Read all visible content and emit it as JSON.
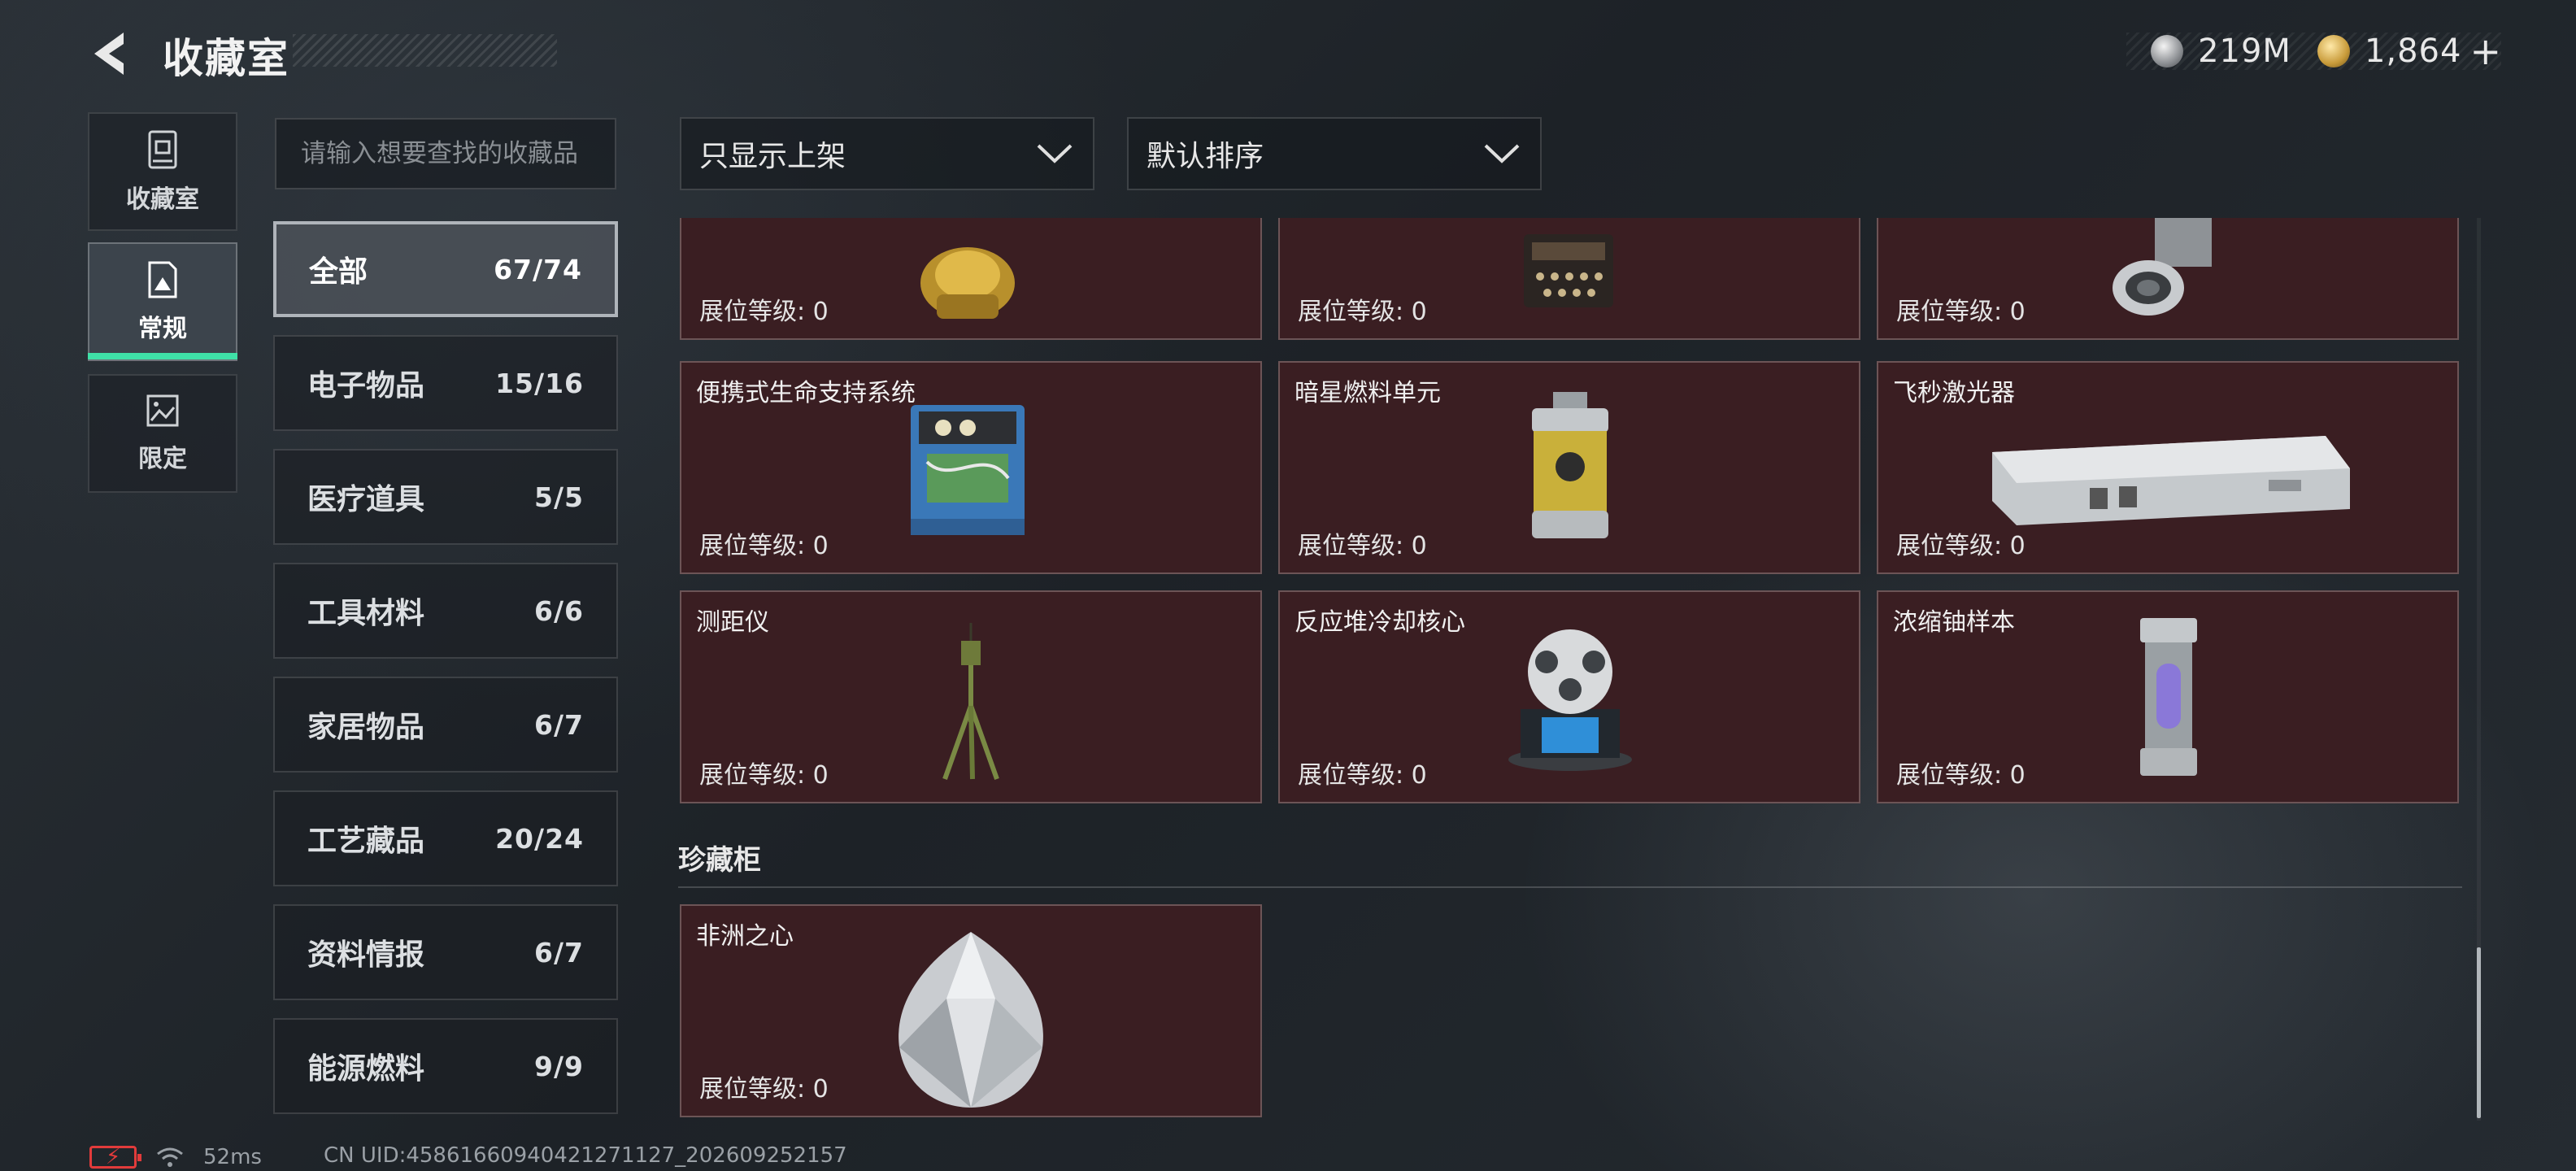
{
  "header": {
    "title": "收藏室"
  },
  "currency": {
    "silver": {
      "icon": "silver-coin-icon",
      "value": "219M"
    },
    "gold": {
      "icon": "gold-coin-icon",
      "value": "1,864"
    },
    "add_label": "+"
  },
  "side_tabs": [
    {
      "label": "收藏室",
      "icon": "collection-icon",
      "active": false
    },
    {
      "label": "常规",
      "icon": "frame-icon",
      "active": true
    },
    {
      "label": "限定",
      "icon": "image-icon",
      "active": false
    }
  ],
  "search": {
    "placeholder": "请输入想要查找的收藏品"
  },
  "filters": {
    "shelf_filter": "只显示上架",
    "sort": "默认排序"
  },
  "categories": [
    {
      "label": "全部",
      "count": "67/74",
      "active": true
    },
    {
      "label": "电子物品",
      "count": "15/16"
    },
    {
      "label": "医疗道具",
      "count": "5/5"
    },
    {
      "label": "工具材料",
      "count": "6/6"
    },
    {
      "label": "家居物品",
      "count": "6/7"
    },
    {
      "label": "工艺藏品",
      "count": "20/24"
    },
    {
      "label": "资料情报",
      "count": "6/7"
    },
    {
      "label": "能源燃料",
      "count": "9/9"
    }
  ],
  "level_label": "展位等级: 0",
  "items_partial": [
    {
      "name": "",
      "icon": "gold-statue-icon"
    },
    {
      "name": "",
      "icon": "typewriter-icon"
    },
    {
      "name": "",
      "icon": "lens-device-icon"
    }
  ],
  "items": [
    {
      "name": "便携式生命支持系统",
      "icon": "life-support-icon"
    },
    {
      "name": "暗星燃料单元",
      "icon": "fuel-canister-icon"
    },
    {
      "name": "飞秒激光器",
      "icon": "laser-device-icon"
    },
    {
      "name": "测距仪",
      "icon": "rangefinder-tripod-icon"
    },
    {
      "name": "反应堆冷却核心",
      "icon": "reactor-core-icon"
    },
    {
      "name": "浓缩铀样本",
      "icon": "uranium-capsule-icon"
    }
  ],
  "cabinet": {
    "title": "珍藏柜",
    "items": [
      {
        "name": "非洲之心",
        "icon": "diamond-icon"
      }
    ]
  },
  "status_bar": {
    "ping": "52ms",
    "uid": "CN UID:4586166094042127​1127_202609252157"
  }
}
